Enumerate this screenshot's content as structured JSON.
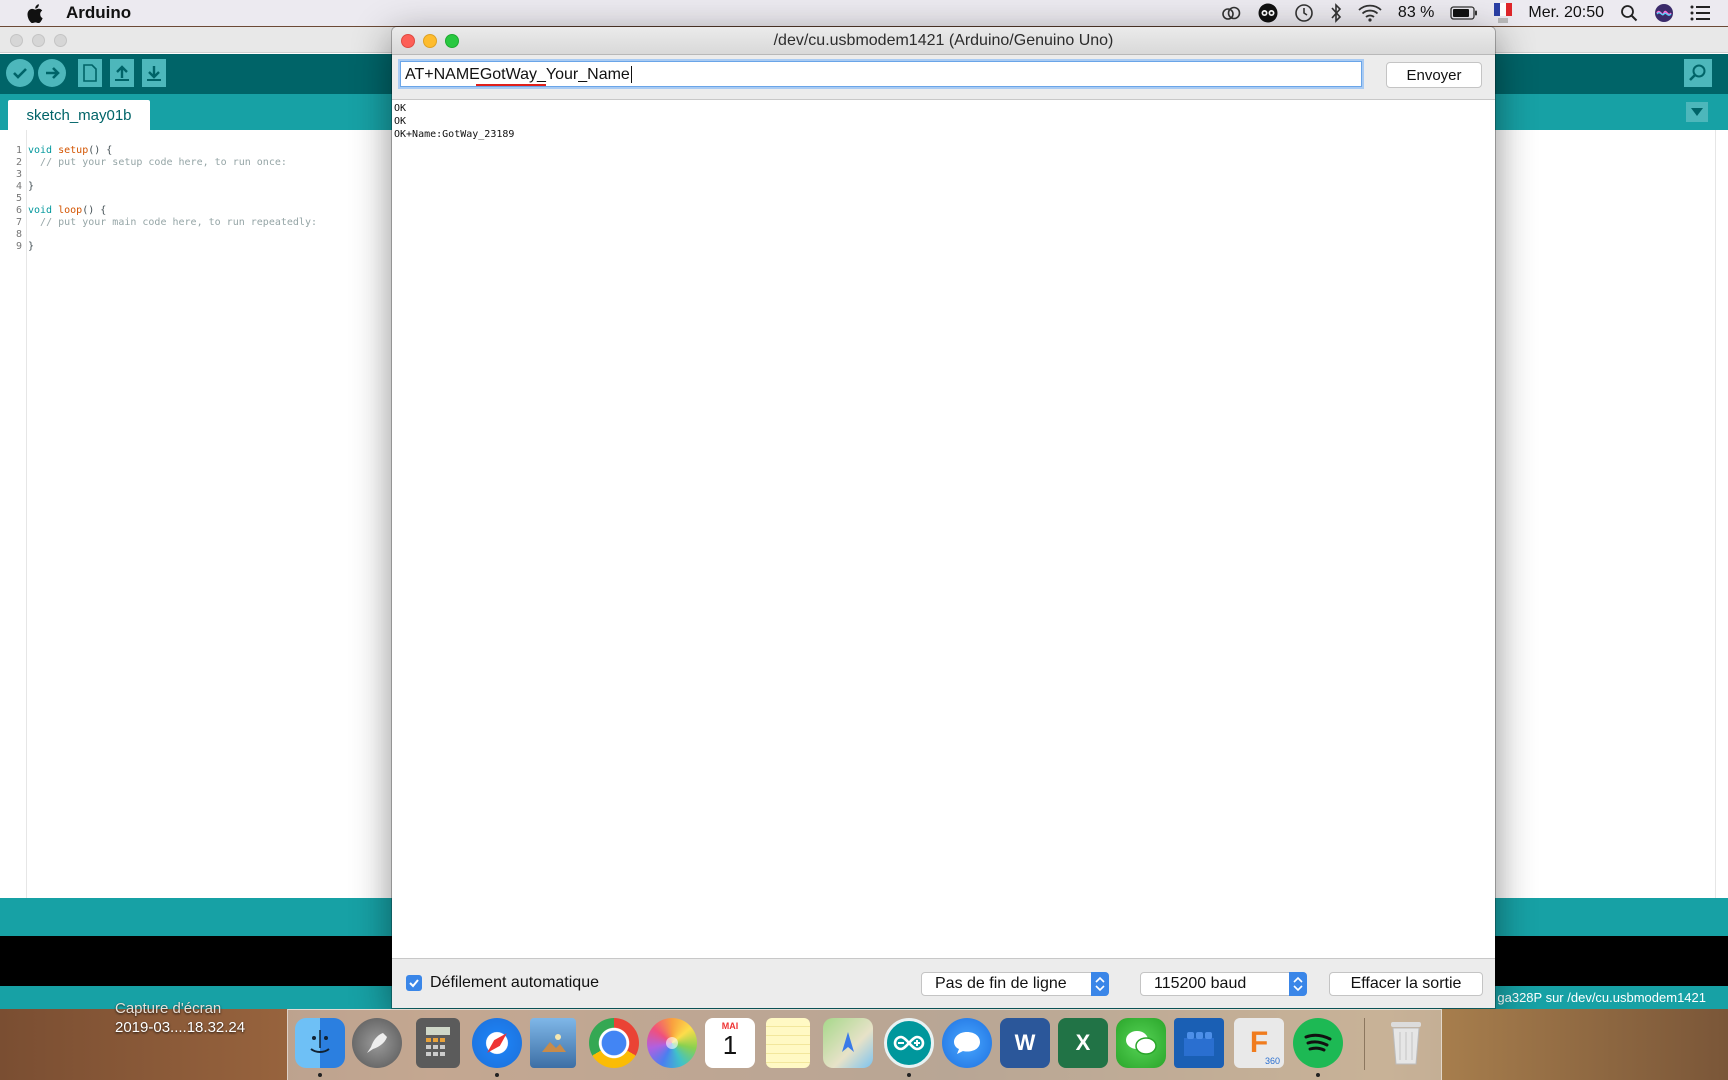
{
  "menubar": {
    "app_name": "Arduino",
    "battery_percent": "83 %",
    "clock": "Mer. 20:50"
  },
  "ide": {
    "tab_label": "sketch_may01b",
    "code_lines": [
      {
        "n": "1",
        "kw": "void",
        "fn": " setup",
        "rest": "() {",
        "cm": ""
      },
      {
        "n": "2",
        "kw": "",
        "fn": "",
        "rest": "  ",
        "cm": "// put your setup code here, to run once:"
      },
      {
        "n": "3",
        "kw": "",
        "fn": "",
        "rest": "",
        "cm": ""
      },
      {
        "n": "4",
        "kw": "",
        "fn": "",
        "rest": "}",
        "cm": ""
      },
      {
        "n": "5",
        "kw": "",
        "fn": "",
        "rest": "",
        "cm": ""
      },
      {
        "n": "6",
        "kw": "void",
        "fn": " loop",
        "rest": "() {",
        "cm": ""
      },
      {
        "n": "7",
        "kw": "",
        "fn": "",
        "rest": "  ",
        "cm": "// put your main code here, to run repeatedly:"
      },
      {
        "n": "8",
        "kw": "",
        "fn": "",
        "rest": "",
        "cm": ""
      },
      {
        "n": "9",
        "kw": "",
        "fn": "",
        "rest": "}",
        "cm": ""
      }
    ],
    "board_status": "ga328P sur /dev/cu.usbmodem1421"
  },
  "serial": {
    "title": "/dev/cu.usbmodem1421 (Arduino/Genuino Uno)",
    "input_value": "AT+NAMEGotWay_Your_Name",
    "send_label": "Envoyer",
    "output_lines": [
      "OK",
      "OK",
      "OK+Name:GotWay_23189"
    ],
    "autoscroll_label": "Défilement automatique",
    "line_ending": "Pas de fin de ligne",
    "baud_rate": "115200 baud",
    "clear_label": "Effacer la sortie"
  },
  "desktop": {
    "file_label_line1": "Capture d'écran",
    "file_label_line2": "2019-03....18.32.24"
  },
  "dock": {
    "calendar_month": "MAI",
    "calendar_day": "1",
    "fusion_badge": "360",
    "word_letter": "W",
    "excel_letter": "X"
  }
}
